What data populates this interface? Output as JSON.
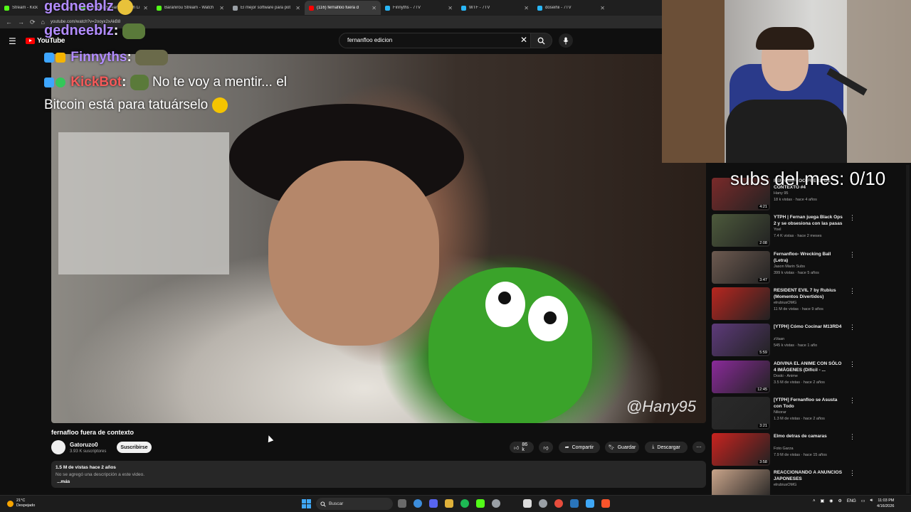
{
  "browser": {
    "tabs": [
      {
        "title": "Stream - Kick",
        "color": "#53fc18",
        "active": false
      },
      {
        "title": "Synthblz Stream - Watch Li",
        "color": "#53fc18",
        "active": false
      },
      {
        "title": "Baranirou Stream - Watch",
        "color": "#53fc18",
        "active": false
      },
      {
        "title": "El mejor software para pot",
        "color": "#9aa0a6",
        "active": false
      },
      {
        "title": "(116) fernafloo fuera d",
        "color": "#ff0000",
        "active": true
      },
      {
        "title": "Finnyths - 7TV",
        "color": "#29b6f6",
        "active": false
      },
      {
        "title": "WTF - 7TV",
        "color": "#29b6f6",
        "active": false
      },
      {
        "title": "doseihii - 7TV",
        "color": "#29b6f6",
        "active": false
      }
    ],
    "url": "youtube.com/watch?v=2ooyx2xAkB8"
  },
  "youtube": {
    "logo_text": "YouTube",
    "search_value": "fernanfloo edicion",
    "video_title": "fernafloo fuera de contexto",
    "watermark": "@Hany95",
    "channel": {
      "name": "Gatoruzo0",
      "subs": "3.93 K suscriptores",
      "subscribe_label": "Suscribirse"
    },
    "actions": {
      "likes": "86 k",
      "share": "Compartir",
      "save": "Guardar",
      "download": "Descargar"
    },
    "description": {
      "views": "1.5 M de vistas  hace 2 años",
      "text": "No se agregó una descripción a este video.",
      "more": "...más"
    }
  },
  "stream_overlay": {
    "chat": [
      {
        "user": "gedneeblz",
        "message": ""
      },
      {
        "user": "gedneeblz",
        "message": ""
      },
      {
        "user": "Finnyths",
        "message": ""
      },
      {
        "user": "KickBot",
        "message": "No te voy a mentir... el"
      },
      {
        "user": "",
        "message": "Bitcoin está para tatuárselo"
      }
    ],
    "subs_text": "subs del mes: 0/10"
  },
  "recommendations": [
    {
      "title": "FERNANFLOO FUERA DE CONTEXTO #4",
      "channel": "Hany 95",
      "meta": "18 k vistas · hace 4 años",
      "duration": "4:21",
      "thumb": "#7a2a2a"
    },
    {
      "title": "YTPH | Fernan juega Black Ops 2 y se obsesiona con las pasas",
      "channel": "Yoel",
      "meta": "7.4 K vistas · hace 2 meses",
      "duration": "2:08",
      "thumb": "#4d5a3c"
    },
    {
      "title": "Fernanfloo- Wrecking Ball (Letra)",
      "channel": "Jason Marin Subs",
      "meta": "399 k vistas · hace 5 años",
      "duration": "3:47",
      "thumb": "#6d5a50"
    },
    {
      "title": "RESIDENT EVIL 7 by Rubius (Momentos Divertidos)",
      "channel": "elrubiusOMG",
      "meta": "11 M de vistas · hace 9 años",
      "duration": "",
      "thumb": "#b8261f"
    },
    {
      "title": "[YTPH] Cómo Cocinar M13RD4",
      "channel": "zVaan",
      "meta": "545 k vistas · hace 1 año",
      "duration": "5:59",
      "thumb": "#5d3a7a"
    },
    {
      "title": "ADIVINA EL ANIME CON SÓLO 4 IMÁGENES (Difícil - ...",
      "channel": "Doski - Anime",
      "meta": "3.5 M de vistas · hace 2 años",
      "duration": "12:45",
      "thumb": "#8a2a9a"
    },
    {
      "title": "[YTPH] Fernanfloo se Asusta con Todo",
      "channel": "Nikorar",
      "meta": "1.3 M de vistas · hace 2 años",
      "duration": "3:21",
      "thumb": "#2a2a2a"
    },
    {
      "title": "Elmo detras de camaras",
      "channel": "Foto Garza",
      "meta": "7.9 M de vistas · hace 15 años",
      "duration": "3:58",
      "thumb": "#c8231f"
    },
    {
      "title": "REACCIONANDO A ANUNCIOS JAPONESES",
      "channel": "elrubiusOMG",
      "meta": "",
      "duration": "",
      "thumb": "#c9a48a"
    }
  ],
  "taskbar": {
    "weather_temp": "21°C",
    "weather_desc": "Despejado",
    "search_label": "Buscar",
    "lang": "ENG",
    "time": "11:03 PM",
    "date": "4/16/2026"
  }
}
